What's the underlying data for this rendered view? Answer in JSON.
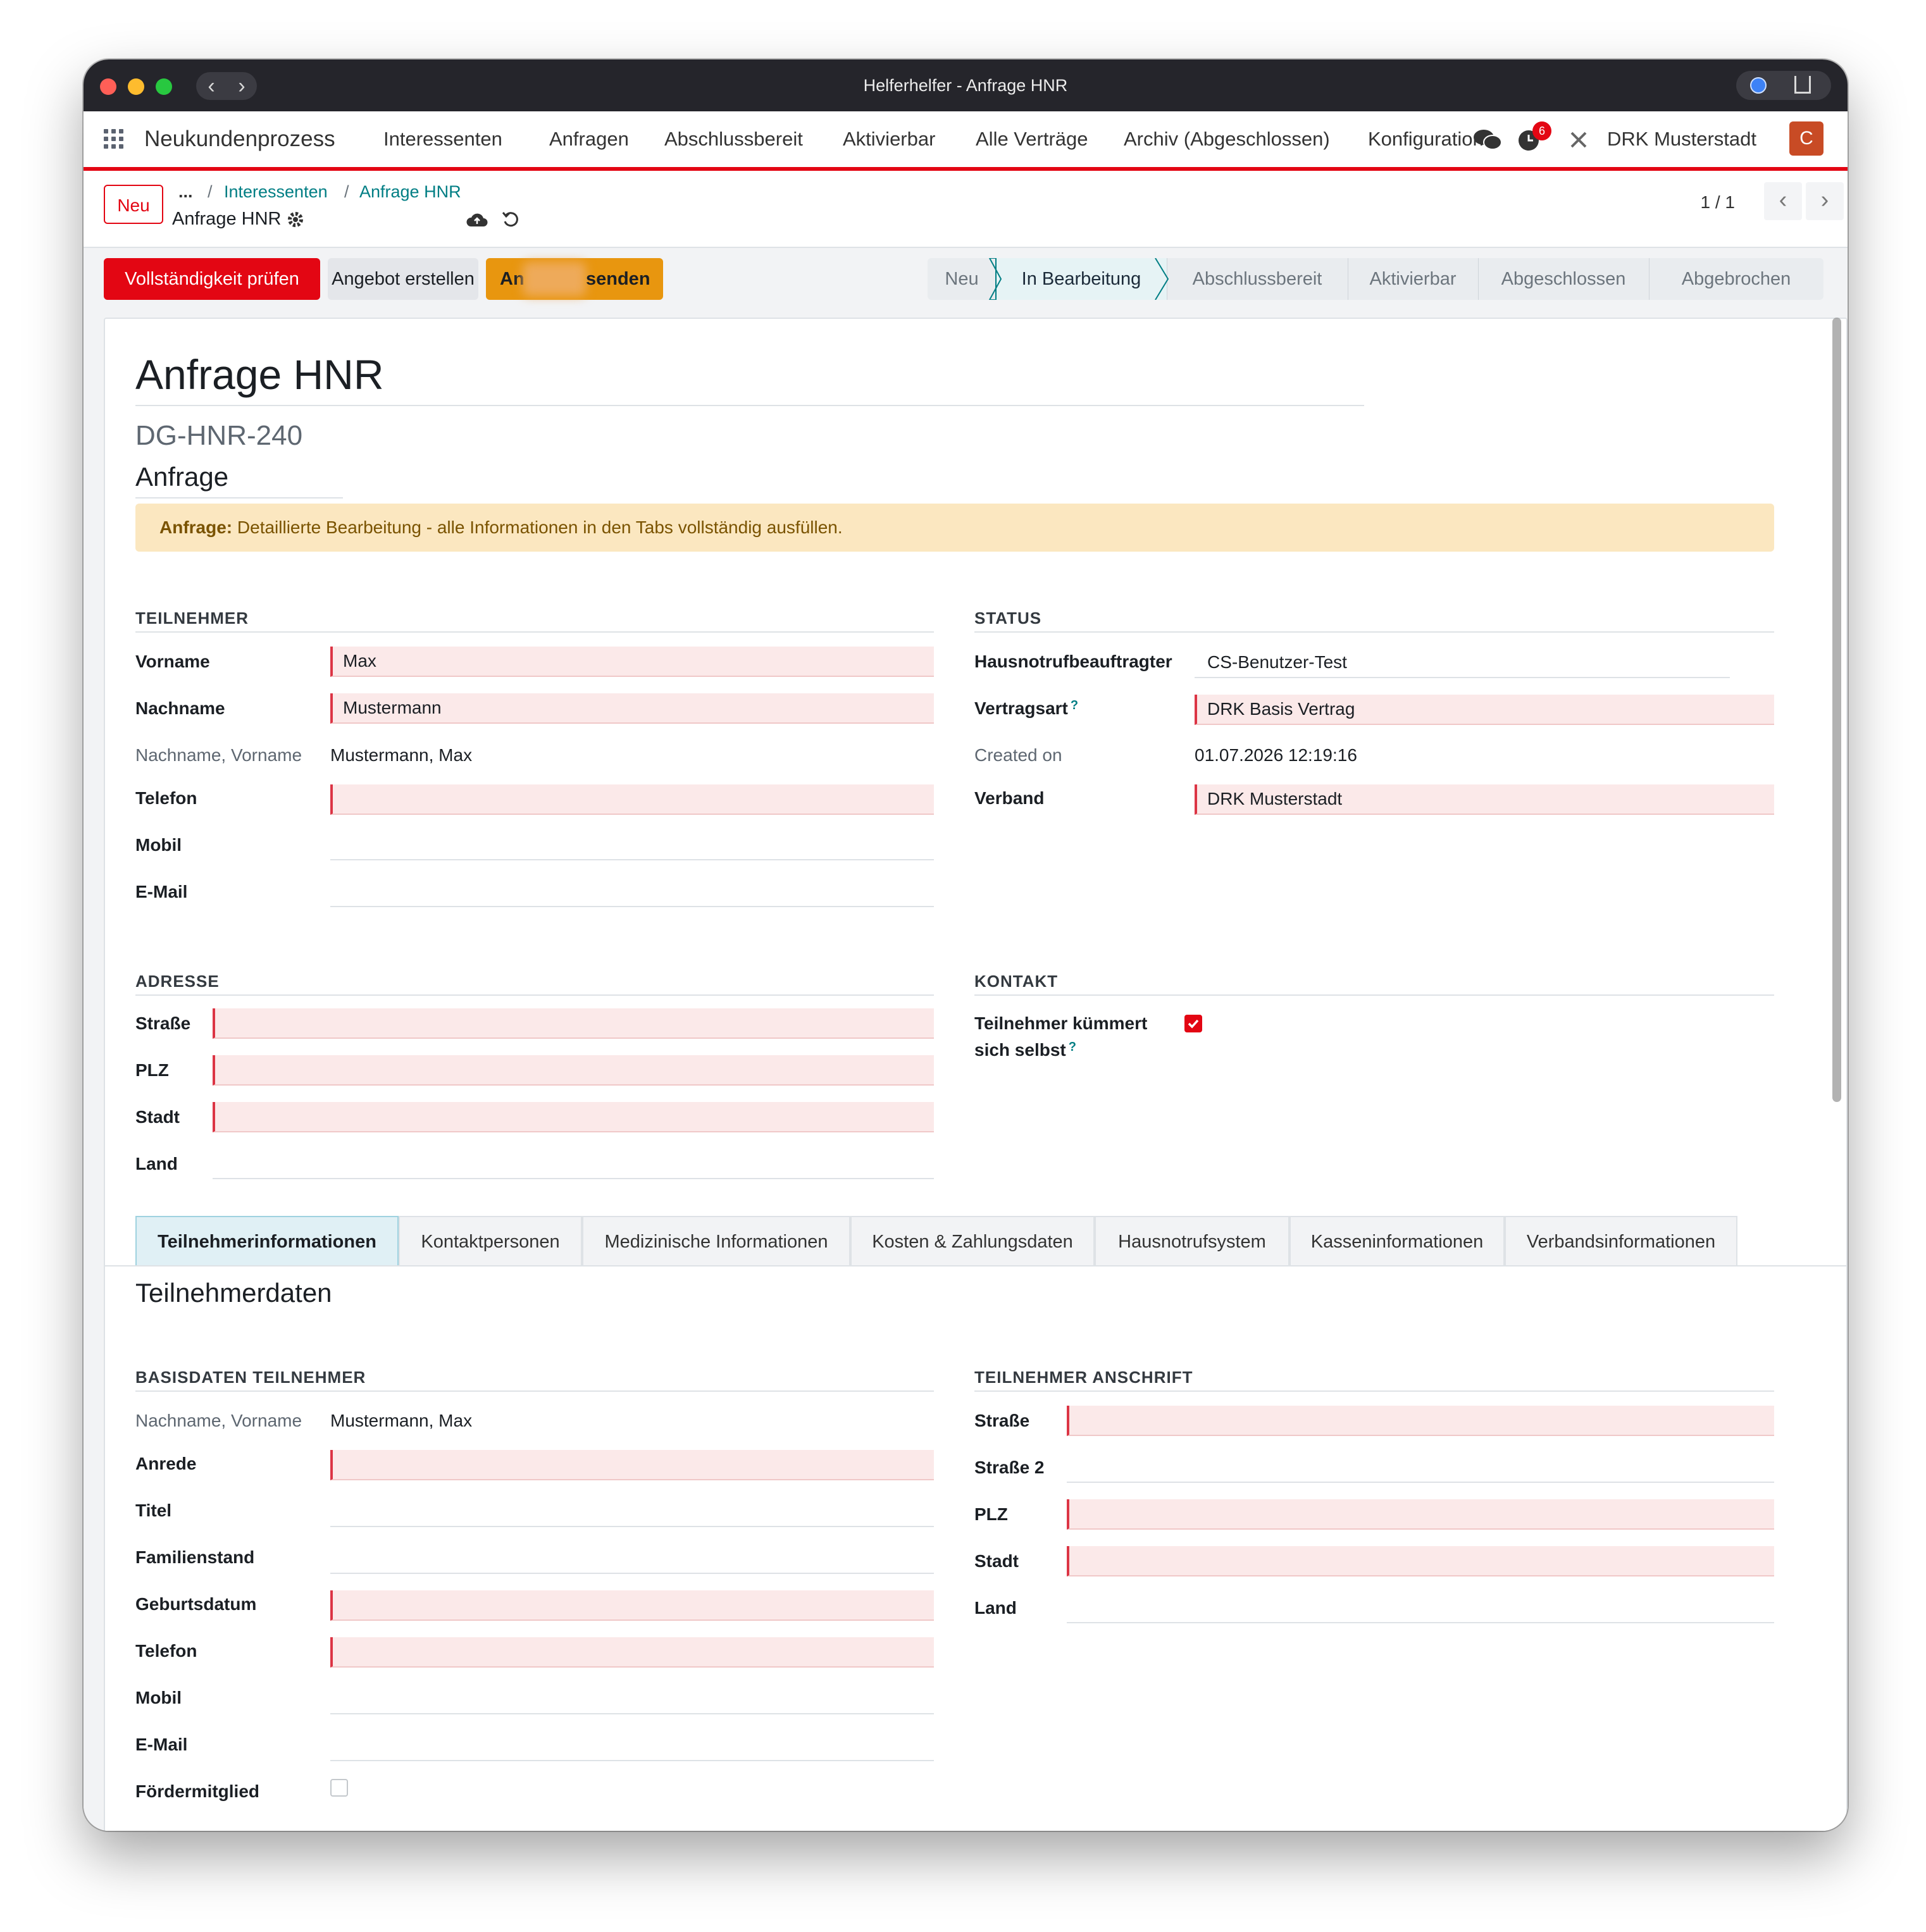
{
  "window": {
    "title": "Helferhelfer - Anfrage HNR"
  },
  "navbar": {
    "app_name": "Neukundenprozess",
    "menu": [
      "Interessenten",
      "Anfragen",
      "Abschlussbereit",
      "Aktivierbar",
      "Alle Verträge",
      "Archiv (Abgeschlossen)",
      "Konfiguration"
    ],
    "activity_count": "6",
    "company": "DRK Musterstadt",
    "avatar_initial": "C"
  },
  "control_panel": {
    "new_button": "Neu",
    "breadcrumb": {
      "ellipsis": "...",
      "parent": "Interessenten",
      "current": "Anfrage HNR",
      "record": "Anfrage HNR"
    },
    "pager": "1 / 1"
  },
  "actions": {
    "check": "Vollständigkeit prüfen",
    "offer": "Angebot erstellen",
    "send_prefix": "An",
    "send_suffix": "senden"
  },
  "stages": [
    "Neu",
    "In Bearbeitung",
    "Abschlussbereit",
    "Aktivierbar",
    "Abgeschlossen",
    "Abgebrochen"
  ],
  "active_stage": "In Bearbeitung",
  "record": {
    "title": "Anfrage HNR",
    "reference": "DG-HNR-240",
    "type": "Anfrage",
    "alert_label": "Anfrage:",
    "alert_text": " Detaillierte Bearbeitung - alle Informationen in den Tabs vollständig ausfüllen."
  },
  "teilnehmer": {
    "heading": "TEILNEHMER",
    "vorname_label": "Vorname",
    "vorname": "Max",
    "nachname_label": "Nachname",
    "nachname": "Mustermann",
    "fullname_label": "Nachname, Vorname",
    "fullname": "Mustermann, Max",
    "telefon_label": "Telefon",
    "telefon": "",
    "mobil_label": "Mobil",
    "mobil": "",
    "email_label": "E-Mail",
    "email": ""
  },
  "status": {
    "heading": "STATUS",
    "beauftragter_label": "Hausnotrufbeauftragter",
    "beauftragter": "CS-Benutzer-Test",
    "vertragsart_label": "Vertragsart",
    "vertragsart": "DRK Basis Vertrag",
    "created_label": "Created on",
    "created": "01.07.2026 12:19:16",
    "verband_label": "Verband",
    "verband": "DRK Musterstadt"
  },
  "adresse": {
    "heading": "ADRESSE",
    "strasse_label": "Straße",
    "plz_label": "PLZ",
    "stadt_label": "Stadt",
    "land_label": "Land"
  },
  "kontakt": {
    "heading": "KONTAKT",
    "self_label_1": "Teilnehmer kümmert",
    "self_label_2": "sich selbst",
    "self_checked": true
  },
  "tabs": [
    "Teilnehmerinformationen",
    "Kontaktpersonen",
    "Medizinische Informationen",
    "Kosten & Zahlungsdaten",
    "Hausnotrufsystem",
    "Kasseninformationen",
    "Verbandsinformationen"
  ],
  "tab_content": {
    "title": "Teilnehmerdaten",
    "basis_heading": "BASISDATEN TEILNEHMER",
    "anschrift_heading": "TEILNEHMER ANSCHRIFT",
    "basis": {
      "fullname_label": "Nachname, Vorname",
      "fullname": "Mustermann, Max",
      "anrede_label": "Anrede",
      "titel_label": "Titel",
      "familienstand_label": "Familienstand",
      "geburtsdatum_label": "Geburtsdatum",
      "telefon_label": "Telefon",
      "mobil_label": "Mobil",
      "email_label": "E-Mail",
      "foerder_label": "Fördermitglied",
      "foerder_checked": false
    },
    "anschrift": {
      "strasse_label": "Straße",
      "strasse2_label": "Straße 2",
      "plz_label": "PLZ",
      "stadt_label": "Stadt",
      "land_label": "Land"
    }
  },
  "colors": {
    "brand_red": "#e30613",
    "warning": "#e8960f",
    "link_teal": "#017e84"
  }
}
